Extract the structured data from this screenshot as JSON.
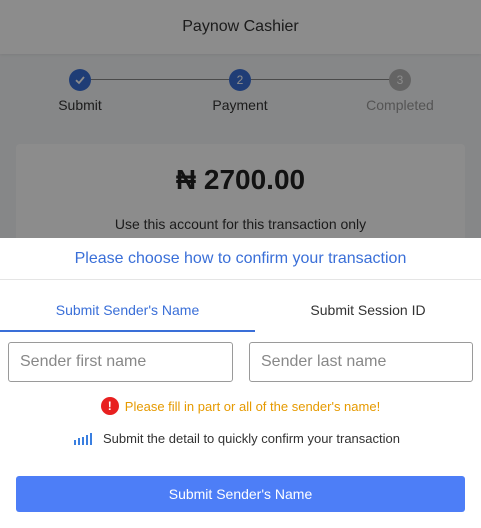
{
  "header": {
    "title": "Paynow Cashier"
  },
  "stepper": {
    "steps": [
      {
        "label": "Submit",
        "state": "done",
        "icon": "check-icon"
      },
      {
        "label": "Payment",
        "number": "2",
        "state": "active"
      },
      {
        "label": "Completed",
        "number": "3",
        "state": "pending"
      }
    ]
  },
  "amount_card": {
    "amount": "₦ 2700.00",
    "note": "Use this account for this transaction only"
  },
  "sheet": {
    "title": "Please choose how to confirm your transaction",
    "tabs": [
      {
        "label": "Submit Sender's Name",
        "active": true
      },
      {
        "label": "Submit Session ID",
        "active": false
      }
    ],
    "first_name": {
      "value": "",
      "placeholder": "Sender first name"
    },
    "last_name": {
      "value": "",
      "placeholder": "Sender last name"
    },
    "error": {
      "icon": "!",
      "text": "Please fill in part or all of the sender's name!"
    },
    "hint": {
      "icon": "signal-bars-icon",
      "text": "Submit the detail to quickly confirm your transaction"
    },
    "submit_label": "Submit Sender's Name"
  },
  "colors": {
    "accent": "#3a6fd8",
    "button": "#4d7ef7",
    "error_icon": "#e82020",
    "error_text": "#e69a00"
  }
}
